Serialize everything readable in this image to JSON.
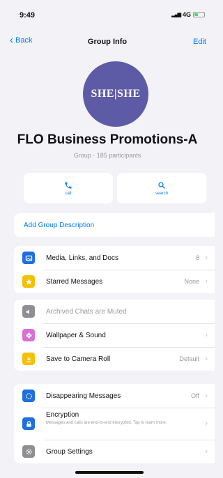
{
  "status": {
    "time": "9:49",
    "network": "4G"
  },
  "nav": {
    "back_label": "Back",
    "title": "Group Info",
    "edit_label": "Edit"
  },
  "group": {
    "avatar_text": "SHE|SHE",
    "name": "FLO Business Promotions-A",
    "subtitle": "Group · 185 participants"
  },
  "actions": [
    {
      "label": "call",
      "icon": "phone-icon"
    },
    {
      "label": "search",
      "icon": "search-icon"
    }
  ],
  "description": {
    "label": "Add Group Description"
  },
  "section1": [
    {
      "label": "Media, Links, and Docs",
      "value": "8",
      "icon": "photo-icon",
      "color": "#1e6fe0"
    },
    {
      "label": "Starred Messages",
      "value": "None",
      "icon": "star-icon",
      "color": "#f5c000"
    }
  ],
  "section2": [
    {
      "label": "Archived Chats are Muted",
      "value": "",
      "icon": "speaker-muted-icon",
      "color": "#8e8e93"
    },
    {
      "label": "Wallpaper & Sound",
      "value": "",
      "icon": "flower-icon",
      "color": "#d86fd8"
    },
    {
      "label": "Save to Camera Roll",
      "value": "Default",
      "icon": "download-icon",
      "color": "#f5c000"
    }
  ],
  "section3": {
    "disappearing": {
      "label": "Disappearing Messages",
      "value": "Off",
      "icon": "timer-icon",
      "color": "#1e6fe0"
    },
    "encryption": {
      "label": "Encryption",
      "sub": "Messages and calls are end-to-end encrypted. Tap to learn more.",
      "icon": "lock-icon",
      "color": "#1e6fe0"
    },
    "settings": {
      "label": "Group Settings",
      "value": "",
      "icon": "gear-icon",
      "color": "#8e8e93"
    }
  }
}
